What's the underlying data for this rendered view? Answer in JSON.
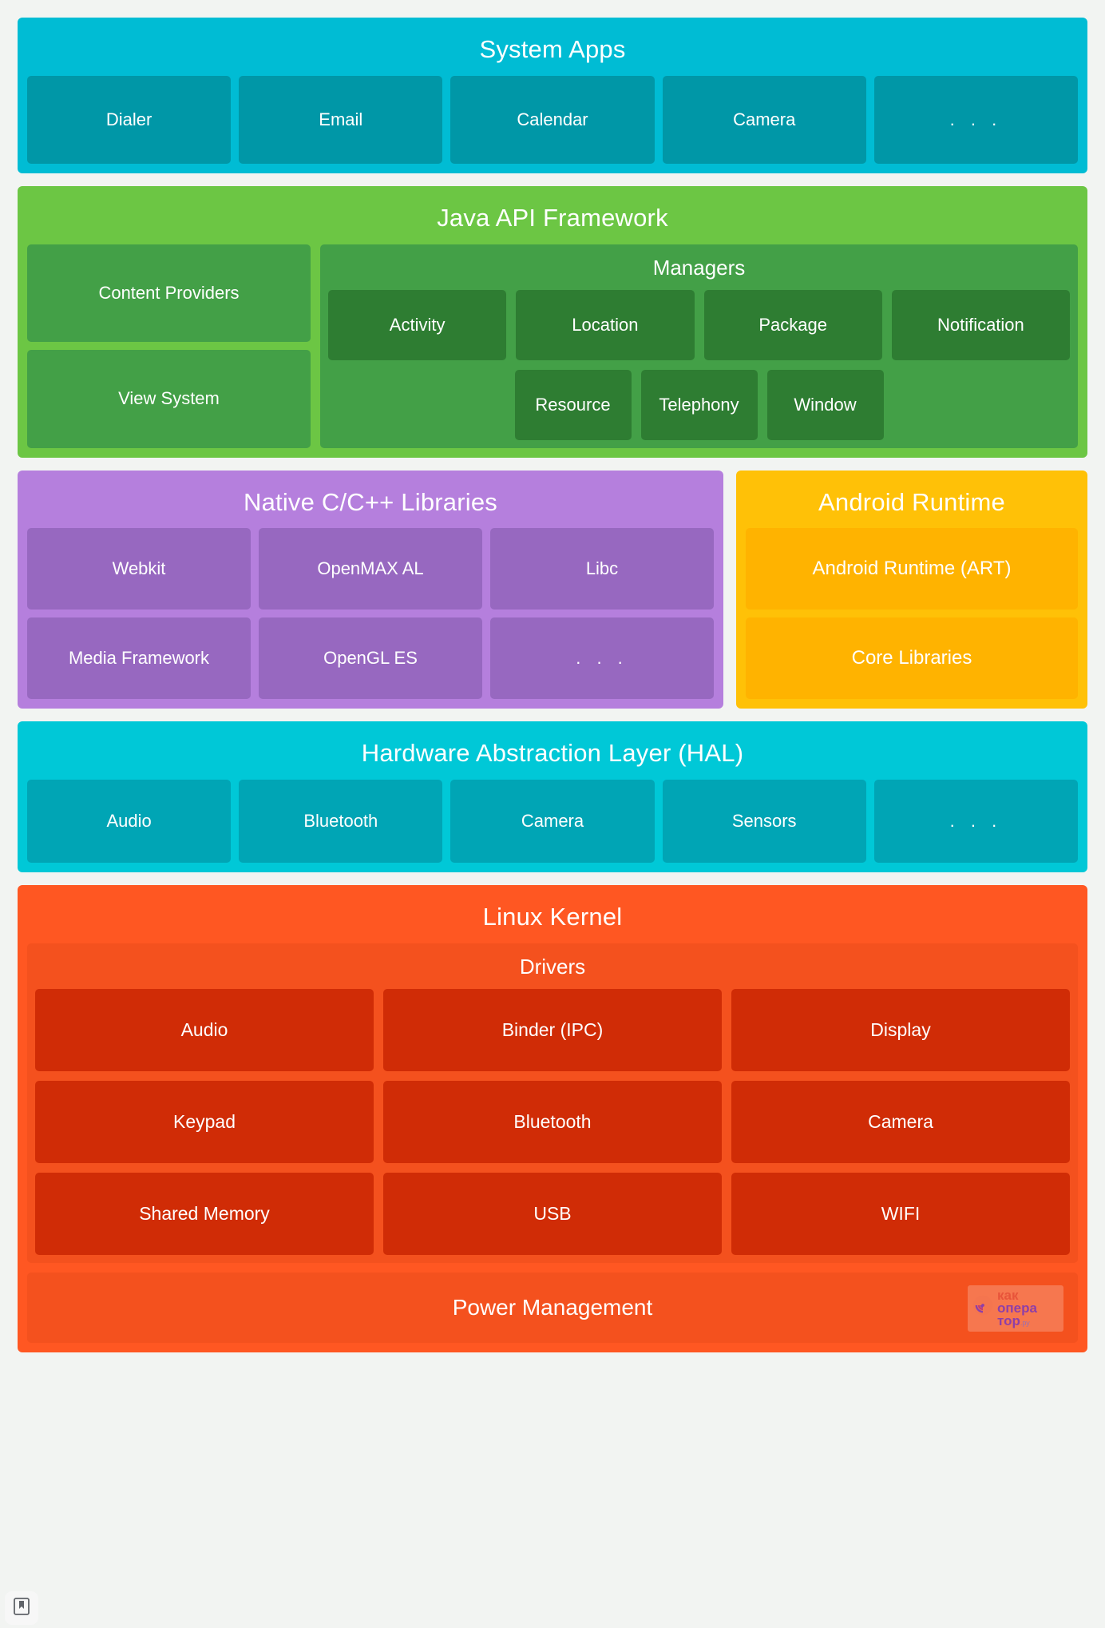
{
  "colors": {
    "page_background": "#f2f4f2",
    "system_apps": "#00bcd4",
    "system_apps_chip": "#0097a7",
    "java_framework": "#6cc644",
    "java_framework_panel": "#43a047",
    "java_framework_chip": "#2e7d32",
    "native_libs": "#b57fdd",
    "native_libs_chip": "#9768c0",
    "android_runtime": "#ffc107",
    "android_runtime_chip": "#ffb300",
    "hal": "#00c8d7",
    "hal_chip": "#00a5b5",
    "linux_kernel": "#ff5722",
    "drivers_panel": "#f4511e",
    "driver_chip": "#d02c06"
  },
  "system_apps": {
    "title": "System Apps",
    "items": [
      "Dialer",
      "Email",
      "Calendar",
      "Camera",
      ". . ."
    ]
  },
  "java_framework": {
    "title": "Java API Framework",
    "left_blocks": [
      "Content Providers",
      "View System"
    ],
    "managers": {
      "title": "Managers",
      "row_top": [
        "Activity",
        "Location",
        "Package",
        "Notification"
      ],
      "row_bottom": [
        "Resource",
        "Telephony",
        "Window"
      ]
    }
  },
  "native_libs": {
    "title": "Native C/C++ Libraries",
    "row_top": [
      "Webkit",
      "OpenMAX AL",
      "Libc"
    ],
    "row_bottom": [
      "Media Framework",
      "OpenGL ES",
      ". . ."
    ]
  },
  "android_runtime": {
    "title": "Android Runtime",
    "items": [
      "Android Runtime (ART)",
      "Core Libraries"
    ]
  },
  "hal": {
    "title": "Hardware Abstraction Layer (HAL)",
    "items": [
      "Audio",
      "Bluetooth",
      "Camera",
      "Sensors",
      ". . ."
    ]
  },
  "linux_kernel": {
    "title": "Linux Kernel",
    "drivers": {
      "title": "Drivers",
      "row1": [
        "Audio",
        "Binder (IPC)",
        "Display"
      ],
      "row2": [
        "Keypad",
        "Bluetooth",
        "Camera"
      ],
      "row3": [
        "Shared Memory",
        "USB",
        "WIFI"
      ]
    },
    "power_management": "Power Management"
  },
  "watermark": {
    "line1": "как",
    "line2": "опера",
    "line3": "тор",
    "suffix": ".ру",
    "icon": "signal-radar-icon"
  },
  "bookmark_badge": {
    "icon": "bookmark-icon"
  }
}
